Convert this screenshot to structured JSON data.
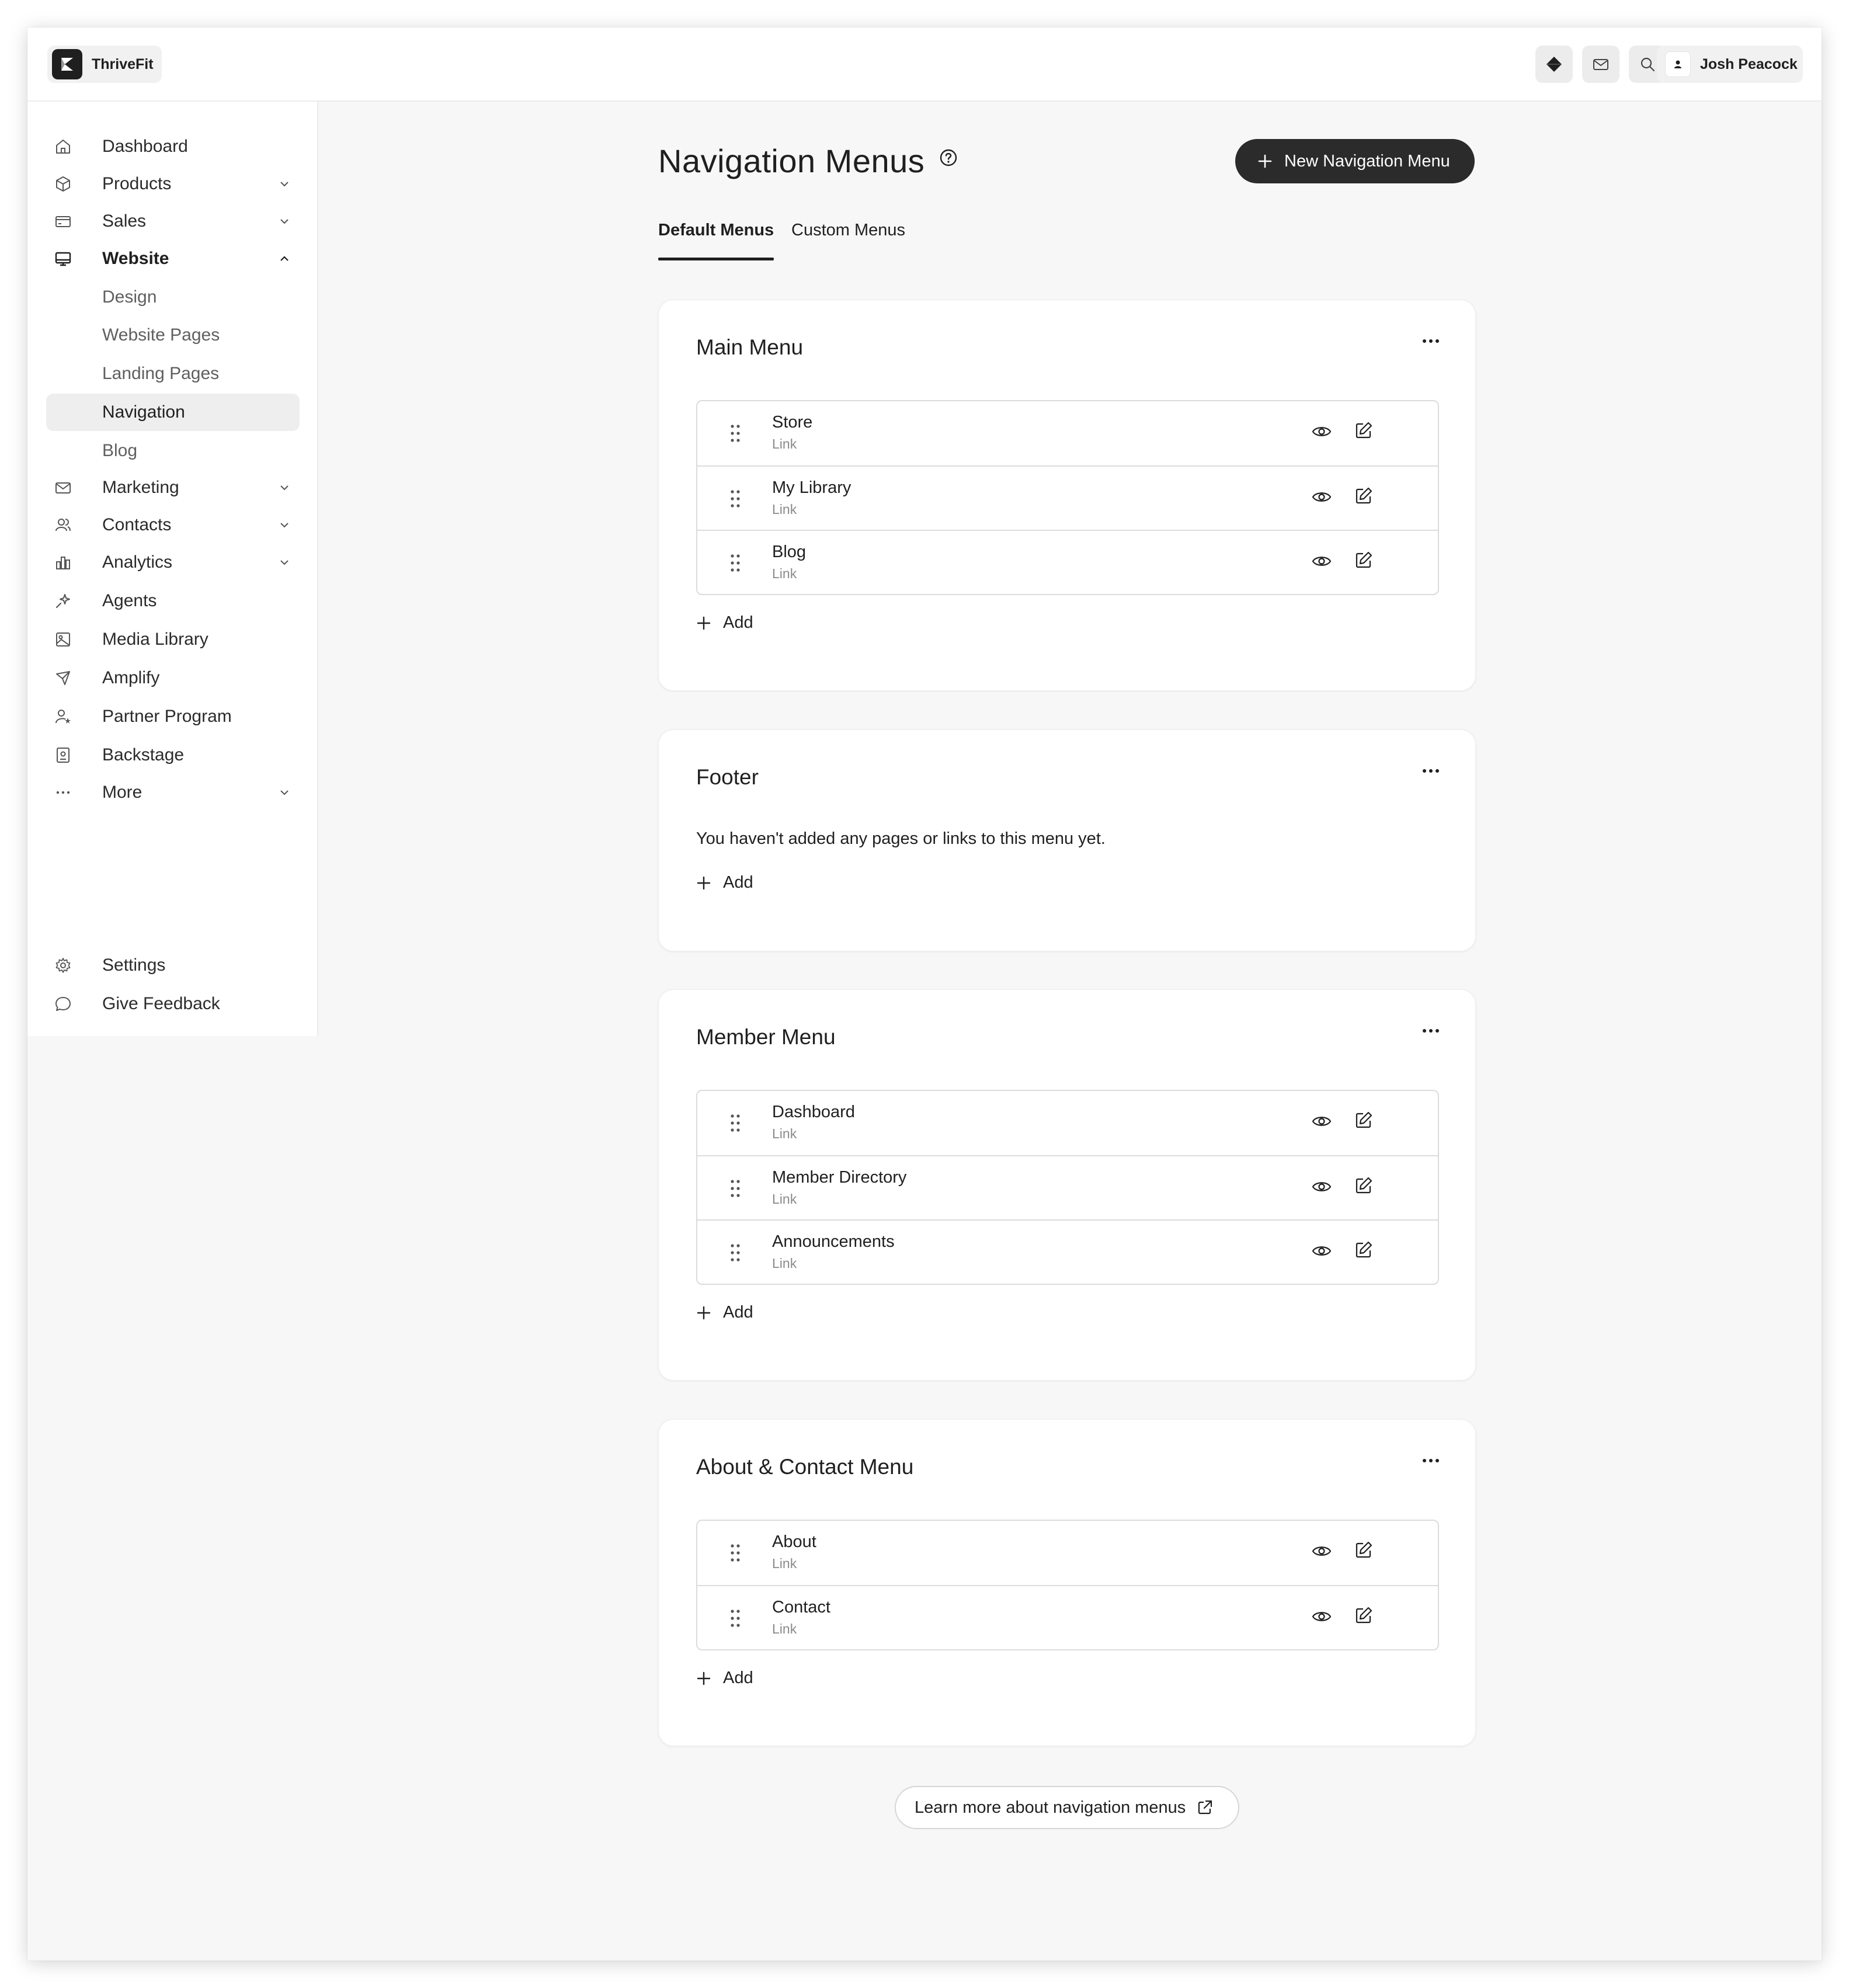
{
  "brand": {
    "name": "ThriveFit"
  },
  "header": {
    "user_name": "Josh Peacock"
  },
  "sidebar": {
    "items": [
      {
        "label": "Dashboard"
      },
      {
        "label": "Products"
      },
      {
        "label": "Sales"
      },
      {
        "label": "Website"
      },
      {
        "label": "Design"
      },
      {
        "label": "Website Pages"
      },
      {
        "label": "Landing Pages"
      },
      {
        "label": "Navigation"
      },
      {
        "label": "Blog"
      },
      {
        "label": "Marketing"
      },
      {
        "label": "Contacts"
      },
      {
        "label": "Analytics"
      },
      {
        "label": "Agents"
      },
      {
        "label": "Media Library"
      },
      {
        "label": "Amplify"
      },
      {
        "label": "Partner Program"
      },
      {
        "label": "Backstage"
      },
      {
        "label": "More"
      }
    ],
    "footer": [
      {
        "label": "Settings"
      },
      {
        "label": "Give Feedback"
      }
    ]
  },
  "main": {
    "title": "Navigation Menus",
    "new_button": "New Navigation Menu",
    "tabs": [
      {
        "label": "Default Menus"
      },
      {
        "label": "Custom Menus"
      }
    ],
    "menus": [
      {
        "title": "Main Menu",
        "items": [
          {
            "name": "Store",
            "type": "Link"
          },
          {
            "name": "My Library",
            "type": "Link"
          },
          {
            "name": "Blog",
            "type": "Link"
          }
        ],
        "add_label": "Add"
      },
      {
        "title": "Footer",
        "empty_message": "You haven't added any pages or links to this menu yet.",
        "add_label": "Add"
      },
      {
        "title": "Member Menu",
        "items": [
          {
            "name": "Dashboard",
            "type": "Link"
          },
          {
            "name": "Member Directory",
            "type": "Link"
          },
          {
            "name": "Announcements",
            "type": "Link"
          }
        ],
        "add_label": "Add"
      },
      {
        "title": "About & Contact Menu",
        "items": [
          {
            "name": "About",
            "type": "Link"
          },
          {
            "name": "Contact",
            "type": "Link"
          }
        ],
        "add_label": "Add"
      }
    ],
    "learn_more": "Learn more about navigation menus"
  },
  "colors": {
    "accent": "#2b2b2b",
    "background": "#f7f7f7",
    "surface": "#ffffff"
  }
}
